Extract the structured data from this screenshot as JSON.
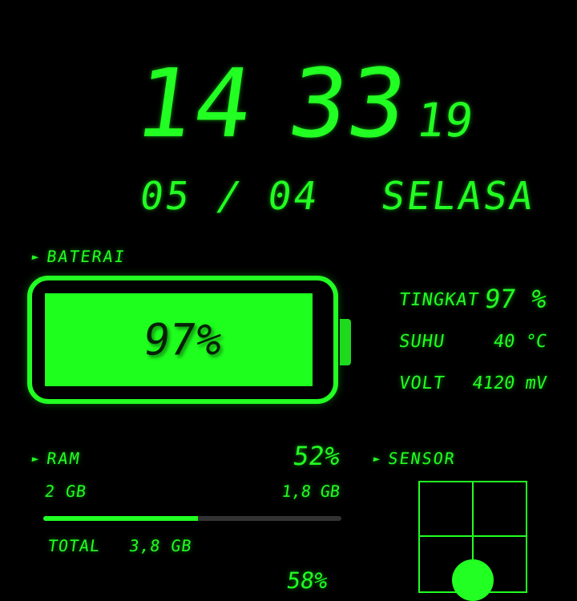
{
  "clock": {
    "hours": "14",
    "minutes": "33",
    "seconds": "19",
    "date": "05 / 04",
    "weekday": "SELASA"
  },
  "battery": {
    "header": "BATERAI",
    "percent_label": "97%",
    "level_percent": 97,
    "stats": [
      {
        "label": "TINGKAT",
        "value": "97 %"
      },
      {
        "label": "SUHU",
        "value": "40 °C"
      },
      {
        "label": "VOLT",
        "value": "4120 mV"
      }
    ]
  },
  "ram": {
    "header": "RAM",
    "percent": "52%",
    "used": "2 GB",
    "free": "1,8 GB",
    "total_label": "TOTAL",
    "total_value": "3,8 GB",
    "level_percent": 52,
    "partial_next_value": "58%"
  },
  "sensor": {
    "header": "SENSOR"
  },
  "colors": {
    "accent": "#22ff22",
    "background": "#000000",
    "battery_fill": "#1eff1e",
    "track": "#333333"
  },
  "icons": {
    "section_arrow": "arrow-right-icon"
  }
}
